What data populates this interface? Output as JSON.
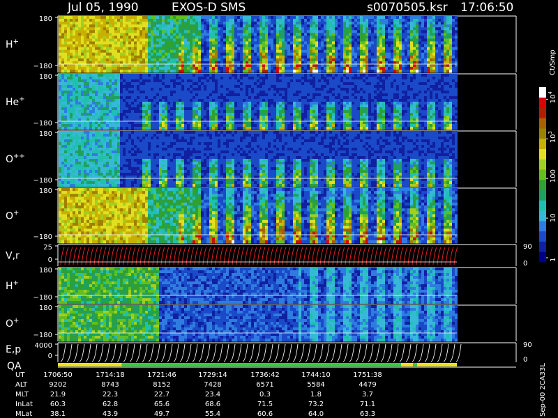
{
  "header": {
    "date": "Jul 05, 1990",
    "instrument": "EXOS-D SMS",
    "file": "s0070505.ksr",
    "time": "17:06:50"
  },
  "chart_data": {
    "type": "heatmap",
    "panels": [
      {
        "id": "hplus",
        "label": "H",
        "sup": "+",
        "ymax": "180",
        "ymin": "−180",
        "style": "high"
      },
      {
        "id": "heplus",
        "label": "He",
        "sup": "+",
        "ymax": "180",
        "ymin": "−180",
        "style": "mid"
      },
      {
        "id": "oplusplus",
        "label": "O",
        "sup": "++",
        "ymax": "180",
        "ymin": "−180",
        "style": "mid"
      },
      {
        "id": "oplus",
        "label": "O",
        "sup": "+",
        "ymax": "180",
        "ymin": "−180",
        "style": "high"
      },
      {
        "id": "vr",
        "label": "V,r",
        "sup": "",
        "ymax": "25",
        "ymin": "0",
        "style": "line",
        "right_ticks": [
          "90",
          "0"
        ]
      },
      {
        "id": "hplus2",
        "label": "H",
        "sup": "+",
        "ymax": "180",
        "ymin": "−180",
        "style": "low"
      },
      {
        "id": "oplus2",
        "label": "O",
        "sup": "+",
        "ymax": "180",
        "ymin": "−180",
        "style": "low"
      },
      {
        "id": "ep",
        "label": "E,p",
        "label2": "QA",
        "sup": "",
        "ymax": "4000",
        "ymin": "0",
        "style": "curves",
        "right_ticks": [
          "90",
          "0"
        ]
      }
    ],
    "colorbar": {
      "unit": "Ct/Smp",
      "ticks": [
        {
          "base": "10",
          "exp": "4",
          "v": 4
        },
        {
          "base": "10",
          "exp": "3",
          "v": 3
        },
        {
          "base": "100",
          "exp": "",
          "v": 2
        },
        {
          "base": "10",
          "exp": "",
          "v": 1
        },
        {
          "base": "1",
          "exp": "",
          "v": 0
        }
      ],
      "colors": [
        "#000080",
        "#1020a0",
        "#1a4ac8",
        "#2f7ce0",
        "#38b8d8",
        "#20c0b0",
        "#20a060",
        "#30a030",
        "#60c020",
        "#a0d020",
        "#e0e020",
        "#c8b000",
        "#a08000",
        "#a86000",
        "#b02000",
        "#e00000",
        "#ffffff"
      ]
    },
    "qa_bar": [
      {
        "from": 0.0,
        "to": 0.16,
        "color": "#f0e020"
      },
      {
        "from": 0.16,
        "to": 0.86,
        "color": "#30d030"
      },
      {
        "from": 0.86,
        "to": 0.89,
        "color": "#f0e020"
      },
      {
        "from": 0.89,
        "to": 0.9,
        "color": "#30d030"
      },
      {
        "from": 0.9,
        "to": 1.0,
        "color": "#f0e020"
      }
    ],
    "orbit_table": {
      "row_labels": [
        "UT",
        "ALT",
        "MLT",
        "InLat",
        "MLat"
      ],
      "columns": [
        [
          "1706:50",
          "9202",
          "21.9",
          "60.3",
          "38.1"
        ],
        [
          "1714:18",
          "8743",
          "22.3",
          "62.8",
          "43.9"
        ],
        [
          "1721:46",
          "8152",
          "22.7",
          "65.6",
          "49.7"
        ],
        [
          "1729:14",
          "7428",
          "23.4",
          "68.6",
          "55.4"
        ],
        [
          "1736:42",
          "6571",
          "0.3",
          "71.5",
          "60.6"
        ],
        [
          "1744:10",
          "5584",
          "1.8",
          "73.2",
          "64.0"
        ],
        [
          "1751:38",
          "4479",
          "3.7",
          "71.1",
          "63.3"
        ]
      ]
    },
    "footer_note": "Sep-00 2CA33L"
  }
}
